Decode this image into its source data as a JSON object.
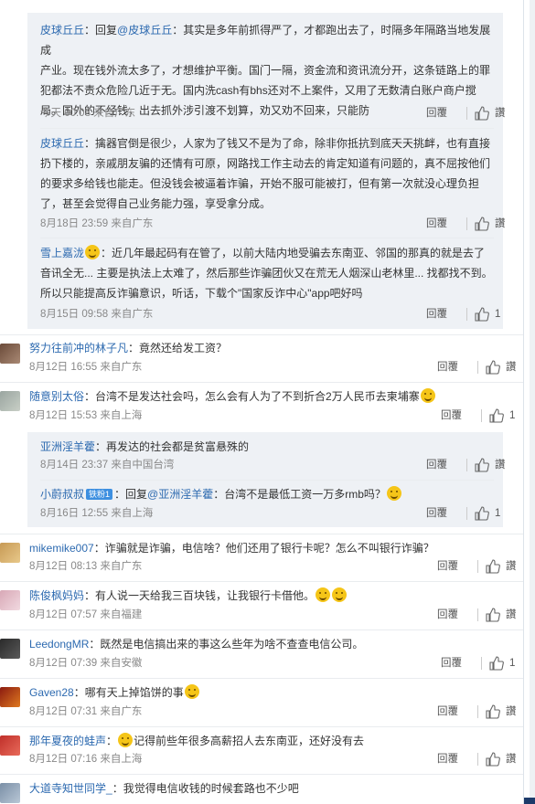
{
  "ui": {
    "reply_label": "回覆",
    "like_label": "讚"
  },
  "nested_block_1": {
    "items": [
      {
        "user": "皮球丘丘",
        "prefix": "：回复",
        "mention": "@皮球丘丘",
        "text_l1": "：其实是多年前抓得严了，才都跑出去了，时隔多年隔路当地发展成",
        "text_l2": "产业。现在钱外流太多了，才想维护平衡。国门一隔，资金流和资讯流分开，这条链路上的罪",
        "text_l3": "犯都法不责众危险几近于无。国内洗cash有bhs还对不上案件，又用了无数清白账户商户搅",
        "text_l4": "局。国外的不经钱，出去抓外涉引渡不划算，劝又劝不回来，只能防",
        "time": "今天 00:08 来自广东",
        "likes": ""
      },
      {
        "user": "皮球丘丘",
        "text_l1": "：擒器官倒是很少，人家为了钱又不是为了命，除非你抵抗到底天天挑衅，也有直接",
        "text_l2": "扔下楼的，亲戚朋友骗的还情有可原，网路找工作主动去的肯定知道有问题的，真不屈按他们",
        "text_l3": "的要求多给钱也能走。但没钱会被逼着诈骗，开始不服可能被打，但有第一次就没心理负担",
        "text_l4": "了，甚至会觉得自己业务能力强，享受拿分成。",
        "time": "8月18日 23:59 来自广东",
        "likes": ""
      },
      {
        "user": "雪上嘉泷",
        "text_l1": "：近几年最起码有在管了，以前大陆内地受骗去东南亚、邻国的那真的就是去了",
        "text_l2": "音讯全无... 主要是执法上太难了，然后那些诈骗团伙又在荒无人烟深山老林里... 找都找不到。",
        "text_l3": "所以只能提高反诈骗意识，听话，下载个\"国家反诈中心\"app吧好吗",
        "time": "8月15日 09:58 来自广东",
        "likes": "1"
      }
    ]
  },
  "comments": [
    {
      "user": "努力往前冲的林子凡",
      "text": "：竟然还给发工资？",
      "time": "8月12日 16:55 来自广东",
      "likes": ""
    },
    {
      "user": "随意别太俗",
      "text": "：台湾不是发达社会吗，怎么会有人为了不到折合2万人民币去柬埔寨",
      "time": "8月12日 15:53 来自上海",
      "likes": "1"
    }
  ],
  "nested_block_2": {
    "items": [
      {
        "user": "亚洲淫羊藿",
        "text": "：再发达的社会都是贫富悬殊的",
        "time": "8月14日 23:37 来自中国台湾",
        "likes": ""
      },
      {
        "user": "小蔚叔叔",
        "badge": "铁粉1",
        "prefix": "：回复",
        "mention": "@亚洲淫羊藿",
        "text": "：台湾不是最低工资一万多rmb吗？",
        "time": "8月16日 12:55 来自上海",
        "likes": "1"
      }
    ]
  },
  "comments2": [
    {
      "user": "mikemike007",
      "text": "：诈骗就是诈骗，电信啥？他们还用了银行卡呢？怎么不叫银行诈骗？",
      "time": "8月12日 08:13 来自广东",
      "likes": ""
    },
    {
      "user": "陈俊枫妈妈",
      "text": "：有人说一天给我三百块钱，让我银行卡借他。",
      "time": "8月12日 07:57 来自福建",
      "likes": ""
    },
    {
      "user": "LeedongMR",
      "text": "：既然是电信搞出来的事这么些年为啥不查查电信公司。",
      "time": "8月12日 07:39 来自安徽",
      "likes": "1"
    },
    {
      "user": "Gaven28",
      "text": "：哪有天上掉馅饼的事",
      "time": "8月12日 07:31 来自广东",
      "likes": ""
    },
    {
      "user": "那年夏夜的蛙声",
      "text": "记得前些年很多高薪招人去东南亚，还好没有去",
      "time": "8月12日 07:16 来自上海",
      "likes": ""
    },
    {
      "user": "大道寺知世同学_",
      "text": "：我觉得电信收钱的时候套路也不少吧",
      "time": "",
      "likes": ""
    }
  ],
  "colors": {
    "link": "#2d6ab0",
    "nested_bg": "#eef1f5",
    "meta": "#888888",
    "scroll_bottom": "#1c3a6a"
  }
}
